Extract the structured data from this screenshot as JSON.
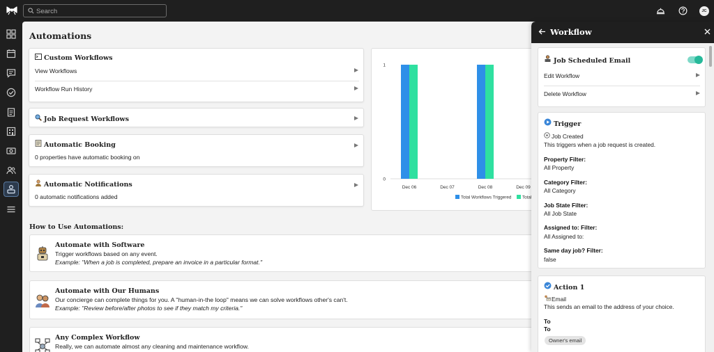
{
  "topbar": {
    "search_placeholder": "Search",
    "avatar_initials": "JC"
  },
  "main": {
    "title": "Automations",
    "cards": {
      "custom": {
        "title": "Custom Workflows",
        "icon": "terminal-icon",
        "rows": [
          "View Workflows",
          "Workflow Run History"
        ]
      },
      "job_request": {
        "title": "Job Request Workflows",
        "icon": "magnifier-icon"
      },
      "booking": {
        "title": "Automatic Booking",
        "icon": "ledger-icon",
        "text": "0 properties have automatic booking on"
      },
      "notifications": {
        "title": "Automatic Notifications",
        "icon": "person-bell-icon",
        "text": "0 automatic notifications added"
      }
    },
    "how_title": "How to Use Automations:",
    "how": [
      {
        "title": "Automate with Software",
        "desc": "Trigger workflows based on any event.",
        "example": "Example: \"When a job is completed, prepare an invoice in a particular format.\""
      },
      {
        "title": "Automate with Our Humans",
        "desc": "Our concierge can complete things for you. A \"human-in-the loop\" means we can solve workflows other's can't.",
        "example": "Example: \"Review before/after photos to see if they match my criteria.\""
      },
      {
        "title": "Any Complex Workflow",
        "desc": "Really, we can automate almost any cleaning and maintenance workflow.",
        "example": ""
      }
    ]
  },
  "chart_data": {
    "type": "bar",
    "categories": [
      "Dec 06",
      "Dec 07",
      "Dec 08",
      "Dec 09"
    ],
    "series": [
      {
        "name": "Total Workflows Triggered",
        "values": [
          1,
          0,
          1,
          0
        ],
        "color": "#2e8fe8"
      },
      {
        "name": "Total",
        "values": [
          1,
          0,
          1,
          0
        ],
        "color": "#2fe0a0"
      }
    ],
    "ylim": [
      0,
      1
    ],
    "yticks": [
      "0",
      "1"
    ],
    "legend": "bottom"
  },
  "panel": {
    "title": "Workflow",
    "job": {
      "title": "Job Scheduled Email",
      "edit": "Edit Workflow",
      "delete": "Delete Workflow",
      "enabled": true
    },
    "trigger": {
      "title": "Trigger",
      "event": "Job Created",
      "desc": "This triggers when a job request is created.",
      "filters": [
        {
          "label": "Property Filter:",
          "value": "All Property"
        },
        {
          "label": "Category Filter:",
          "value": "All Category"
        },
        {
          "label": "Job State Filter:",
          "value": "All Job State"
        },
        {
          "label": "Assigned to: Filter:",
          "value": "All Assigned to:"
        },
        {
          "label": "Same day job? Filter:",
          "value": "false"
        }
      ]
    },
    "action": {
      "title": "Action 1",
      "type": "Email",
      "desc": "This sends an email to the address of your choice.",
      "to_label": "To",
      "to_value": "To",
      "chip": "Owner's email"
    }
  }
}
